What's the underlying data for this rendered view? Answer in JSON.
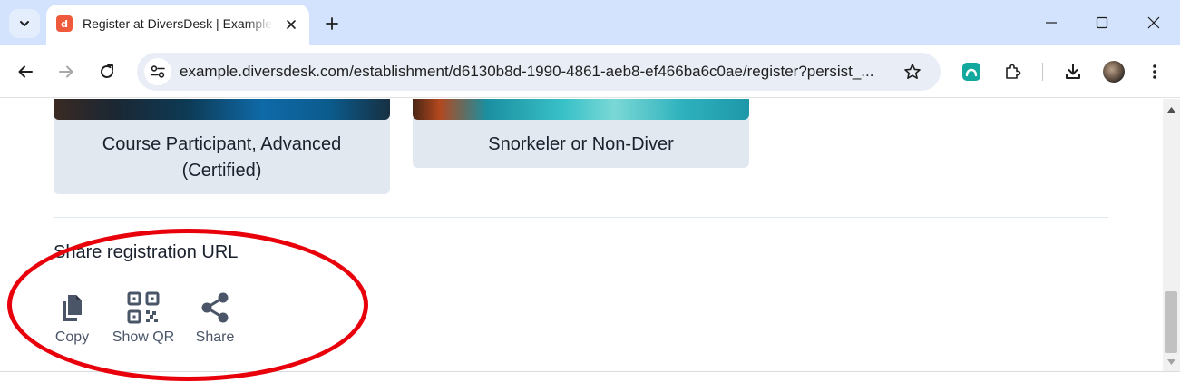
{
  "browser": {
    "tab": {
      "title": "Register at DiversDesk | Example",
      "favicon_glyph": "d"
    },
    "url": "example.diversdesk.com/establishment/d6130b8d-1990-4861-aeb8-ef466ba6c0ae/register?persist_...",
    "colors": {
      "tabstrip": "#d3e3fd",
      "omnibox": "#e9eef6",
      "favicon": "#f05a3c",
      "extension": "#12a89d"
    }
  },
  "page": {
    "cards": [
      {
        "title_line1": "Course Participant, Advanced",
        "title_line2": "(Certified)"
      },
      {
        "title_line1": "Snorkeler or Non-Diver"
      }
    ],
    "share": {
      "heading": "Share registration URL",
      "actions": [
        {
          "label": "Copy",
          "icon": "copy-icon"
        },
        {
          "label": "Show QR",
          "icon": "qr-code-icon"
        },
        {
          "label": "Share",
          "icon": "share-icon"
        }
      ]
    },
    "colors": {
      "card_bg": "#e2e8f0",
      "heading_text": "#1a202c",
      "icon": "#4a5568",
      "annotation": "#e8000b"
    }
  }
}
